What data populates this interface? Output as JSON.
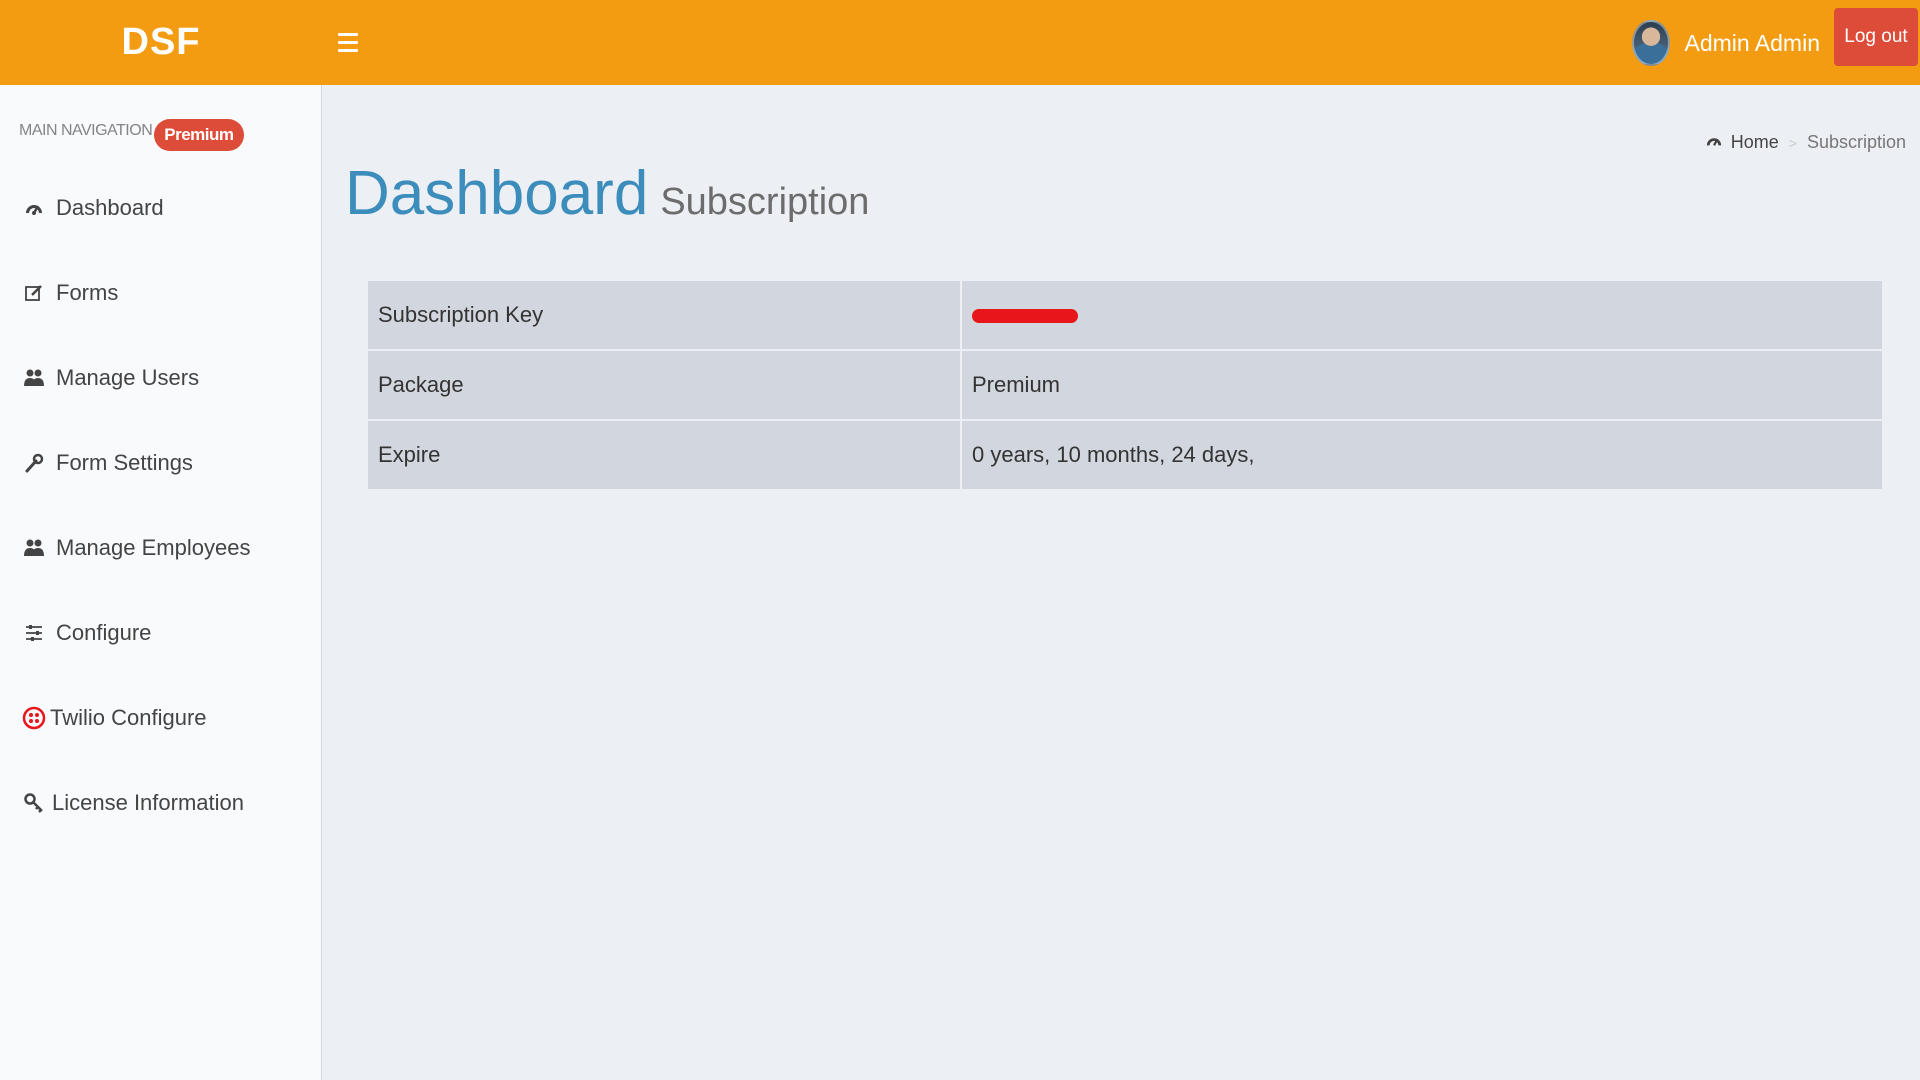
{
  "header": {
    "logo": "DSF",
    "user_name": "Admin Admin",
    "logout_label": "Log out",
    "accent_color": "#f39c12"
  },
  "sidebar": {
    "section_title": "MAIN NAVIGATION",
    "badge": "Premium",
    "items": [
      {
        "label": "Dashboard",
        "icon": "dashboard-icon"
      },
      {
        "label": "Forms",
        "icon": "edit-icon"
      },
      {
        "label": "Manage Users",
        "icon": "users-icon"
      },
      {
        "label": "Form Settings",
        "icon": "wrench-icon"
      },
      {
        "label": "Manage Employees",
        "icon": "users-icon"
      },
      {
        "label": "Configure",
        "icon": "sliders-icon"
      },
      {
        "label": "Twilio Configure",
        "icon": "twilio-icon"
      },
      {
        "label": "License Information",
        "icon": "key-icon"
      }
    ]
  },
  "content": {
    "title": "Dashboard",
    "subtitle": "Subscription",
    "breadcrumb": {
      "home": "Home",
      "current": "Subscription"
    },
    "table": [
      {
        "label": "Subscription Key",
        "value": ""
      },
      {
        "label": "Package",
        "value": "Premium"
      },
      {
        "label": "Expire",
        "value": "0 years, 10 months, 24 days,"
      }
    ]
  }
}
